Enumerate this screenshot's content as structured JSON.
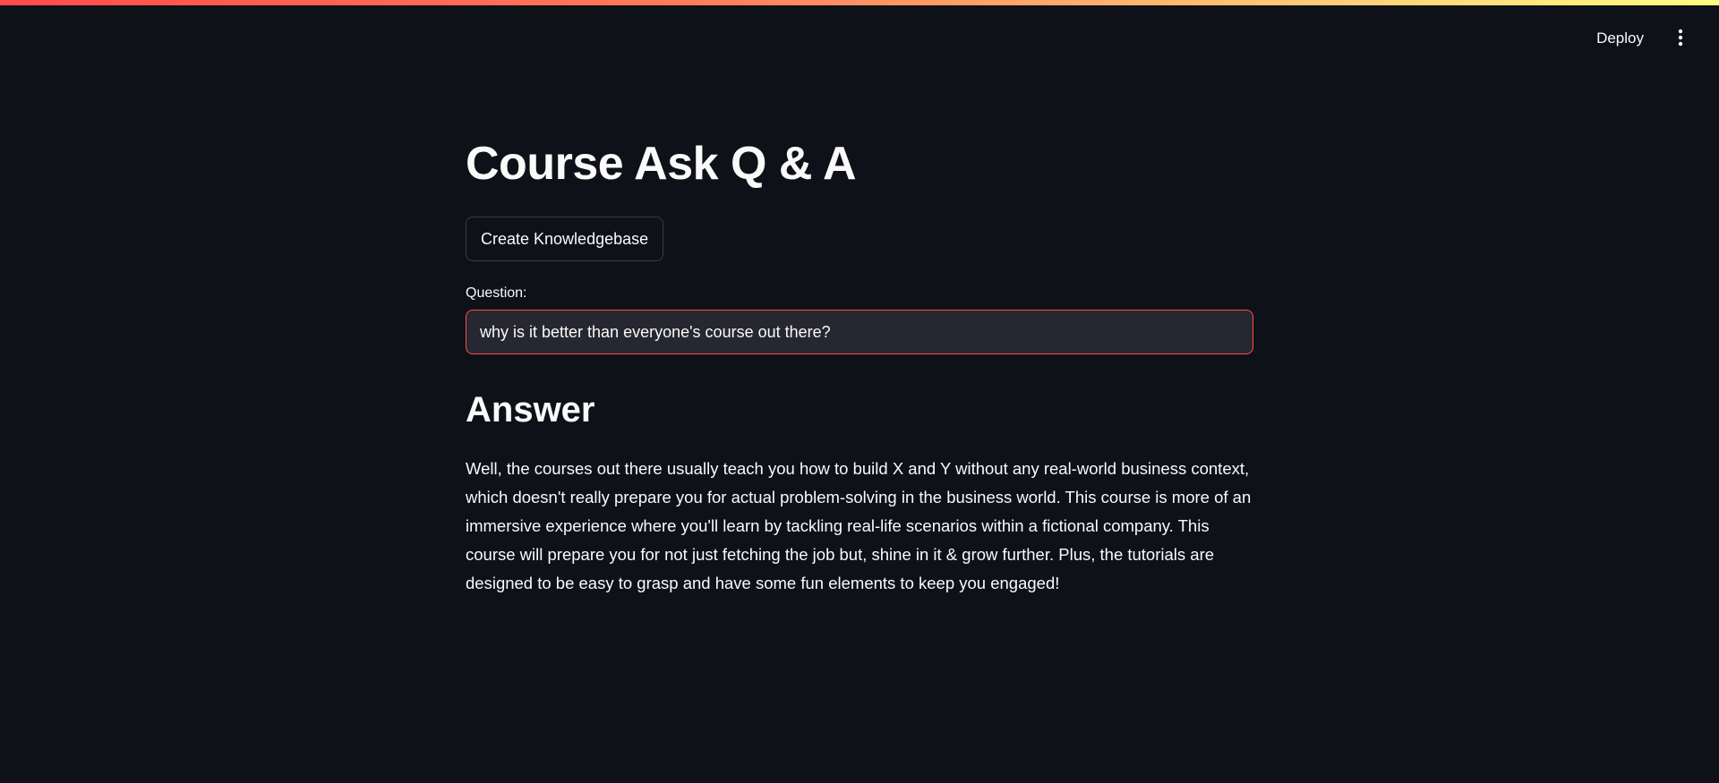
{
  "header": {
    "deploy_label": "Deploy",
    "menu_icon": "vertical-ellipsis-icon",
    "accent_gradient": [
      "#ff4b4b",
      "#fffd80"
    ]
  },
  "main": {
    "title": "Course Ask Q & A",
    "create_kb_label": "Create Knowledgebase",
    "question_label": "Question:",
    "question_value": "why is it better than everyone's course out there?",
    "answer_heading": "Answer",
    "answer_text": "Well, the courses out there usually teach you how to build X and Y without any real-world business context, which doesn't really prepare you for actual problem-solving in the business world. This course is more of an immersive experience where you'll learn by tackling real-life scenarios within a fictional company. This course will prepare you for not just fetching the job but, shine in it & grow further. Plus, the tutorials are designed to be easy to grasp and have some fun elements to keep you engaged!"
  },
  "colors": {
    "background": "#0e1117",
    "input_background": "#262730",
    "input_border_focus": "#ff4b4b",
    "text": "#fafafa"
  }
}
